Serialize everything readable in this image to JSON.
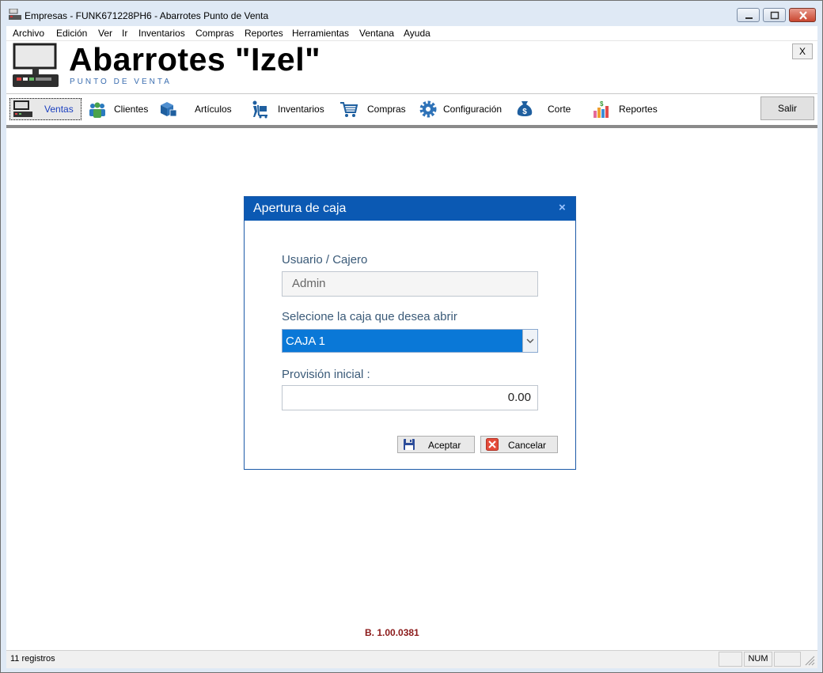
{
  "window": {
    "title": "Empresas - FUNK671228PH6 - Abarrotes Punto de Venta"
  },
  "menubar": {
    "items": [
      "Archivo",
      "Edición",
      "Ver",
      "Ir",
      "Inventarios",
      "Compras",
      "Reportes",
      "Herramientas",
      "Ventana",
      "Ayuda"
    ]
  },
  "header": {
    "title": "Abarrotes \"Izel\"",
    "subtitle": "PUNTO DE VENTA",
    "close_label": "X"
  },
  "toolbar": {
    "items": [
      {
        "label": "Ventas",
        "icon": "cash-register-icon"
      },
      {
        "label": "Clientes",
        "icon": "people-icon"
      },
      {
        "label": "Artículos",
        "icon": "boxes-icon"
      },
      {
        "label": "Inventarios",
        "icon": "dolly-icon"
      },
      {
        "label": "Compras",
        "icon": "cart-icon"
      },
      {
        "label": "Configuración",
        "icon": "gear-icon"
      },
      {
        "label": "Corte",
        "icon": "money-bag-icon"
      },
      {
        "label": "Reportes",
        "icon": "bar-chart-icon"
      }
    ],
    "exit_label": "Salir"
  },
  "dialog": {
    "title": "Apertura de caja",
    "close_glyph": "×",
    "user_label": "Usuario / Cajero",
    "user_value": "Admin",
    "register_label": "Selecione la caja que desea abrir",
    "register_value": "CAJA 1",
    "provision_label": "Provisión inicial :",
    "provision_value": "0.00",
    "accept_label": "Aceptar",
    "cancel_label": "Cancelar"
  },
  "version": "B. 1.00.0381",
  "statusbar": {
    "records": "11 registros",
    "num": "NUM"
  },
  "colors": {
    "dialog_header": "#0b59b3",
    "select_highlight": "#0a78d7",
    "version_text": "#8b1a1a",
    "subtitle": "#3b6eb0"
  }
}
